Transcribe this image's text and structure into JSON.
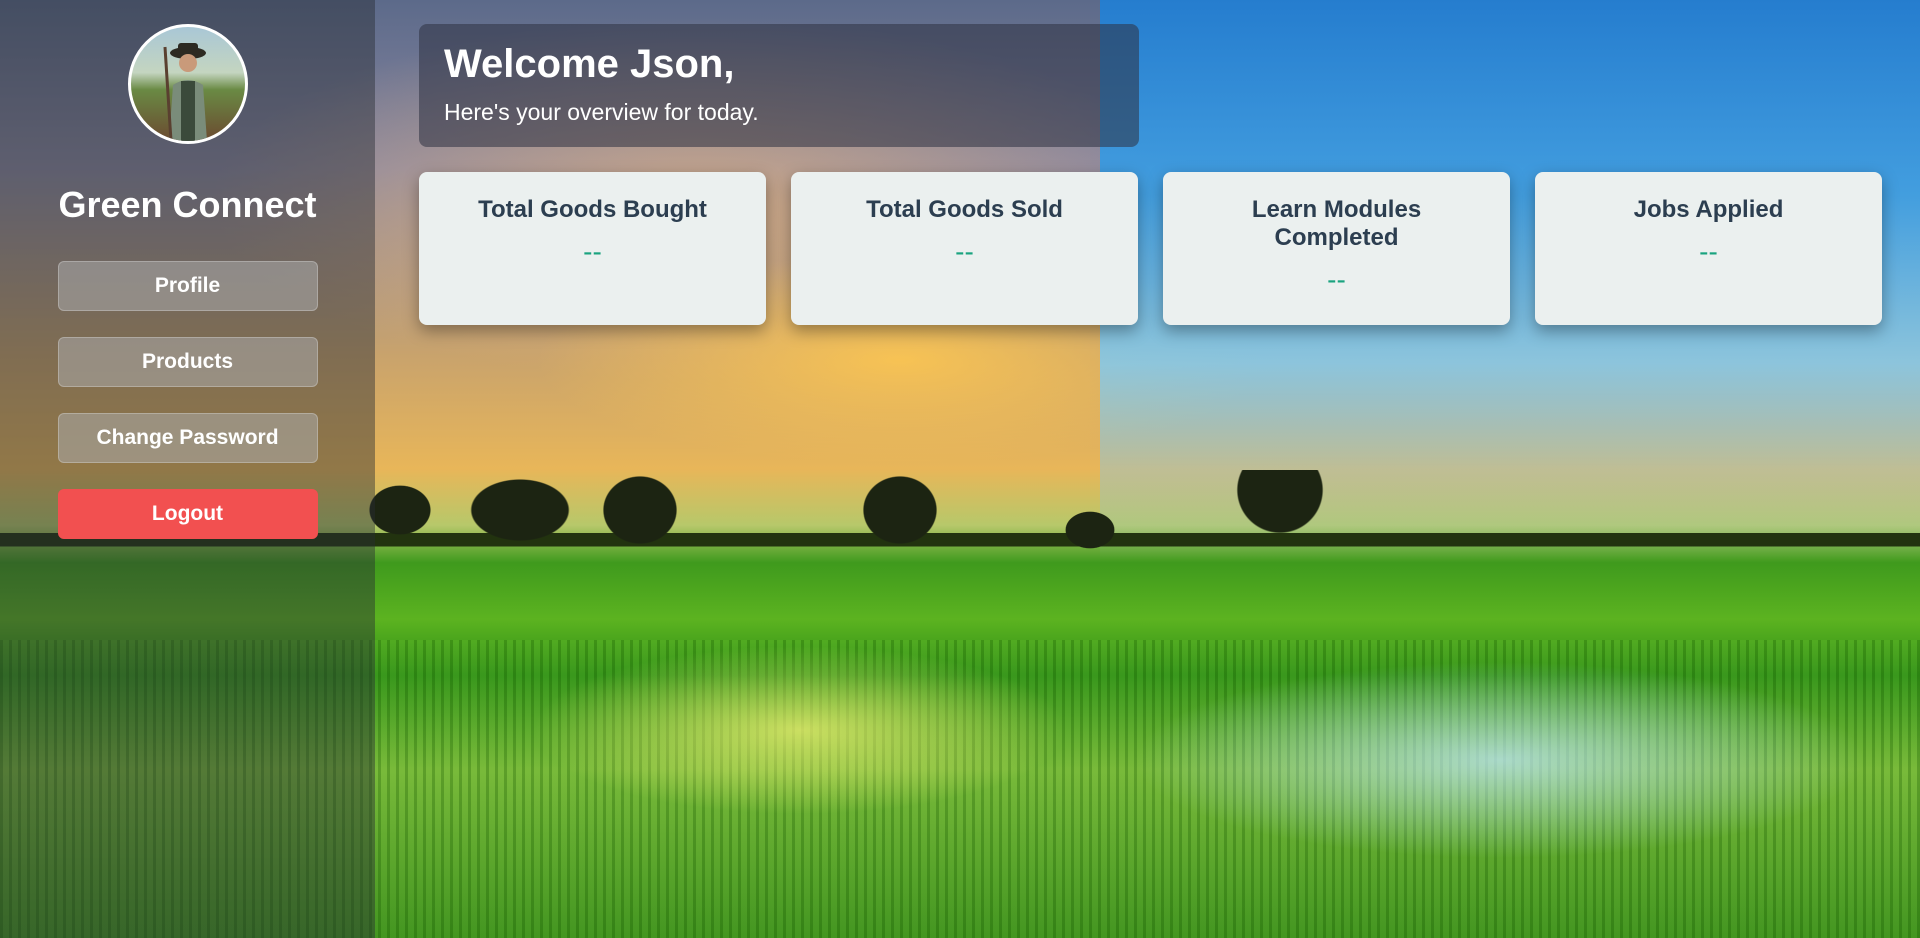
{
  "sidebar": {
    "title": "Green Connect",
    "nav": [
      {
        "label": "Profile"
      },
      {
        "label": "Products"
      },
      {
        "label": "Change Password"
      },
      {
        "label": "Logout"
      }
    ]
  },
  "header": {
    "greeting": "Welcome Json,",
    "subtitle": "Here's your overview for today."
  },
  "stats": [
    {
      "title": "Total Goods Bought",
      "value": "--"
    },
    {
      "title": "Total Goods Sold",
      "value": "--"
    },
    {
      "title": "Learn Modules Completed",
      "value": "--"
    },
    {
      "title": "Jobs Applied",
      "value": "--"
    }
  ],
  "colors": {
    "logout": "#f25050",
    "stat_value": "#1aa37f",
    "card_title": "#2c3e50"
  }
}
